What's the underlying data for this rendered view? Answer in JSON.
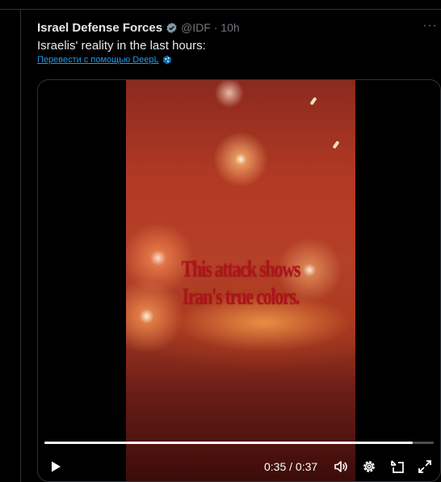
{
  "tweet": {
    "author": "Israel Defense Forces",
    "handle_time": "@IDF · 10h",
    "more_icon": "more-icon",
    "text": "Israelis' reality in the last hours:",
    "translate_label": "Перевести с помощью DeepL"
  },
  "video": {
    "caption_line1": "This attack shows",
    "caption_line2": "Iran's true colors.",
    "current_time": "0:35",
    "duration": "0:37",
    "time_display": "0:35 / 0:37",
    "progress_fraction": 0.946
  },
  "icons": {
    "verified": "verified-badge-icon",
    "translate": "deepl-icon",
    "play": "play-icon",
    "volume": "volume-icon",
    "settings": "settings-icon",
    "pip": "picture-in-picture-icon",
    "fullscreen": "fullscreen-icon"
  },
  "colors": {
    "background": "#000000",
    "text": "#e7e9ea",
    "muted": "#71767b",
    "link": "#1d9bf0",
    "caption": "#b0121a"
  }
}
